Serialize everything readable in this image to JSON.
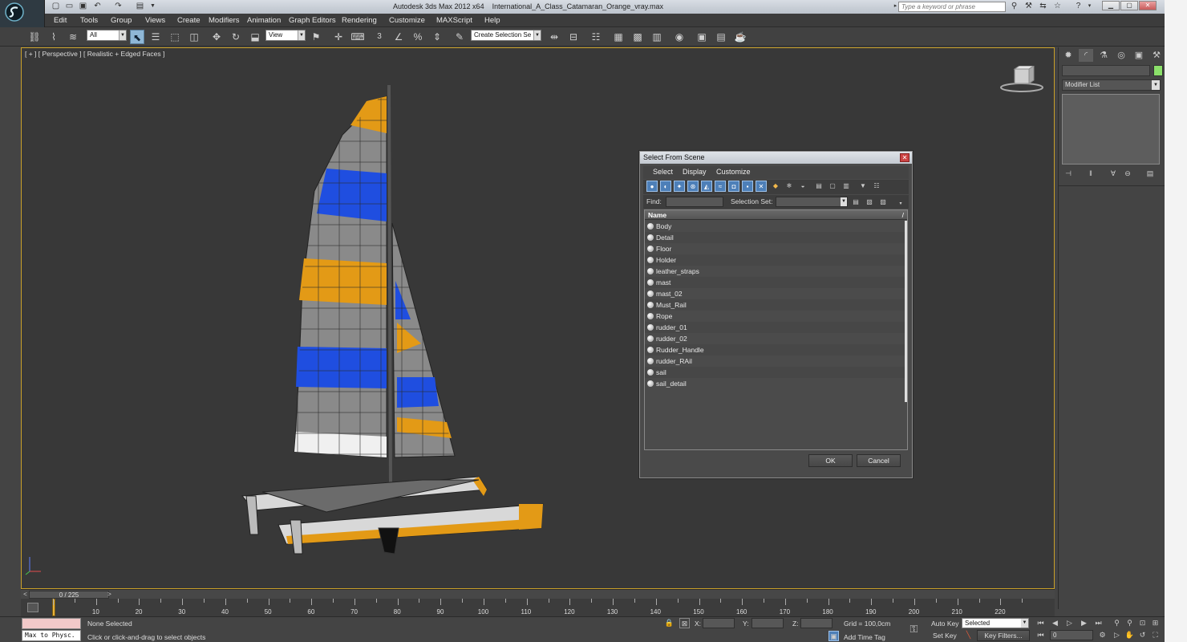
{
  "titlebar": {
    "app_title": "Autodesk 3ds Max  2012 x64",
    "file_name": "International_A_Class_Catamaran_Orange_vray.max",
    "search_placeholder": "Type a keyword or phrase"
  },
  "menubar": {
    "items": [
      "Edit",
      "Tools",
      "Group",
      "Views",
      "Create",
      "Modifiers",
      "Animation",
      "Graph Editors",
      "Rendering",
      "Customize",
      "MAXScript",
      "Help"
    ]
  },
  "toolbar": {
    "selection_filter": "All",
    "reference_coord": "View",
    "named_selection_placeholder": "Create Selection Se",
    "snap_label": "3"
  },
  "viewport": {
    "label": "[ + ] [ Perspective ] [ Realistic + Edged Faces ]"
  },
  "command_panel": {
    "modifier_list": "Modifier List",
    "object_color": "#8be06a"
  },
  "dialog": {
    "title": "Select From Scene",
    "menus": [
      "Select",
      "Display",
      "Customize"
    ],
    "find_label": "Find:",
    "selection_set_label": "Selection Set:",
    "column_header": "Name",
    "sort_indicator": "/",
    "objects": [
      "Body",
      "Detail",
      "Floor",
      "Holder",
      "leather_straps",
      "mast",
      "mast_02",
      "Must_Rail",
      "Rope",
      "rudder_01",
      "rudder_02",
      "Rudder_Handle",
      "rudder_RAil",
      "sail",
      "sail_detail"
    ],
    "ok_label": "OK",
    "cancel_label": "Cancel"
  },
  "timeline": {
    "frame_display": "0 / 225",
    "prev": "<",
    "next": ">",
    "ticks": [
      "10",
      "20",
      "30",
      "40",
      "50",
      "60",
      "70",
      "80",
      "90",
      "100",
      "110",
      "120",
      "130",
      "140",
      "150",
      "160",
      "170",
      "180",
      "190",
      "200",
      "210",
      "220"
    ]
  },
  "statusbar": {
    "maxscript_listener": "Max to Physc.",
    "selection_status": "None Selected",
    "prompt": "Click or click-and-drag to select objects",
    "x_label": "X:",
    "y_label": "Y:",
    "z_label": "Z:",
    "grid": "Grid = 100,0cm",
    "add_time_tag": "Add Time Tag",
    "auto_key": "Auto Key",
    "set_key": "Set Key",
    "key_mode": "Selected",
    "key_filters": "Key Filters...",
    "current_frame": "0"
  },
  "colors": {
    "viewport_border": "#c9a028",
    "sail_orange": "#e39a16",
    "sail_blue": "#1f4ee0",
    "accent_blue": "#4d7fb8"
  }
}
